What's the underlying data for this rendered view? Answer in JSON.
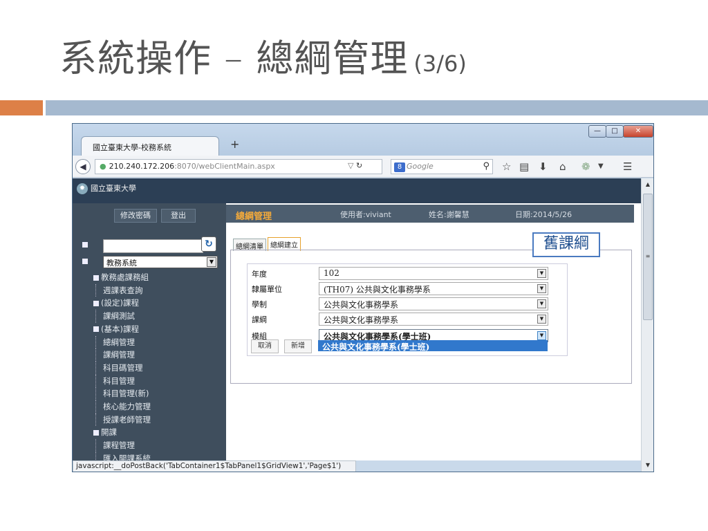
{
  "slide": {
    "title": "系統操作 – 總綱管理",
    "title_sub": "(3/6)"
  },
  "browser": {
    "tab_title": "國立臺東大學-校務系統",
    "new_tab": "+",
    "url_host": "210.240.172.206",
    "url_rest": ":8070/webClientMain.aspx",
    "search_placeholder": "Google",
    "status_text": "javascript:__doPostBack('TabContainer1$TabPanel1$GridView1','Page$1')"
  },
  "sidebar": {
    "change_password": "修改密碼",
    "logout": "登出",
    "system_select": "教務系統",
    "tree": [
      {
        "label": "教務處課務組",
        "children": [
          "週課表查詢"
        ]
      },
      {
        "label": "(設定)課程",
        "children": [
          "課綱測試"
        ]
      },
      {
        "label": "(基本)課程",
        "children": [
          "總綱管理",
          "課綱管理",
          "科目碼管理",
          "科目管理",
          "科目管理(新)",
          "核心能力管理",
          "授課老師管理"
        ]
      },
      {
        "label": "開課",
        "children": [
          "課程管理",
          "匯入開課系統"
        ]
      }
    ]
  },
  "content": {
    "header_title": "總綱管理",
    "user_label": "使用者:viviant",
    "name_label": "姓名:謝馨慧",
    "date_label": "日期:2014/5/26",
    "tabs": [
      "總綱清單",
      "總綱建立"
    ],
    "callout": "舊課綱",
    "form": {
      "rows": [
        {
          "label": "年度",
          "value": "102"
        },
        {
          "label": "隸屬單位",
          "value": "(TH07) 公共與文化事務學系"
        },
        {
          "label": "學制",
          "value": "公共與文化事務學系"
        },
        {
          "label": "課綱",
          "value": "公共與文化事務學系"
        },
        {
          "label": "模組",
          "value": "公共與文化事務學系(學士班)"
        }
      ],
      "dropdown_option": "公共與文化事務學系(學士班)",
      "cancel": "取消",
      "add": "新增"
    }
  },
  "colors": {
    "accent_orange": "#dd8047",
    "accent_blue": "#a5b9cf",
    "header_dark": "#2c3f55",
    "sidebar_bg": "#3f4e5d",
    "title_highlight": "#f2a93b",
    "selection_blue": "#3178cc"
  }
}
